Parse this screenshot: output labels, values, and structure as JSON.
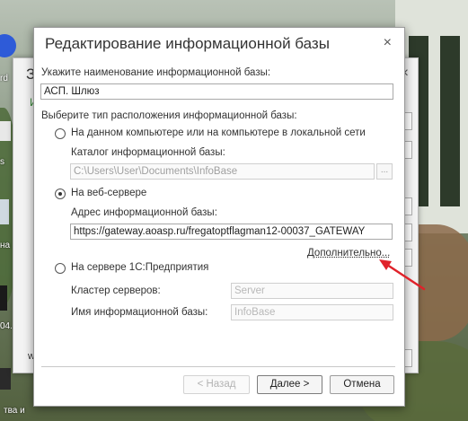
{
  "desktop": {
    "icons": [
      "rd",
      "s",
      "на",
      "04.",
      "тва и"
    ]
  },
  "background_window": {
    "title": "З",
    "close": "×",
    "green_text": "И",
    "bottom_text": "w"
  },
  "dialog": {
    "title": "Редактирование информационной базы",
    "close_glyph": "×",
    "name_label": "Укажите наименование информационной базы:",
    "name_value": "АСП. Шлюз",
    "location_label": "Выберите тип расположения информационной базы:",
    "options": {
      "local": {
        "label": "На данном компьютере или на компьютере в локальной сети",
        "catalog_label": "Каталог информационной базы:",
        "catalog_value": "C:\\Users\\User\\Documents\\InfoBase",
        "browse_label": "..."
      },
      "web": {
        "label": "На веб-сервере",
        "address_label": "Адрес информационной базы:",
        "address_value": "https://gateway.aoasp.ru/fregatoptflagman12-00037_GATEWAY",
        "more_link": "Дополнительно..."
      },
      "server": {
        "label": "На сервере 1С:Предприятия",
        "cluster_label": "Кластер серверов:",
        "cluster_placeholder": "Server",
        "ib_name_label": "Имя информационной базы:",
        "ib_name_placeholder": "InfoBase"
      }
    },
    "selected_option": "web",
    "buttons": {
      "back": "< Назад",
      "next": "Далее >",
      "cancel": "Отмена"
    }
  },
  "colors": {
    "annotation_arrow": "#e0222a"
  }
}
